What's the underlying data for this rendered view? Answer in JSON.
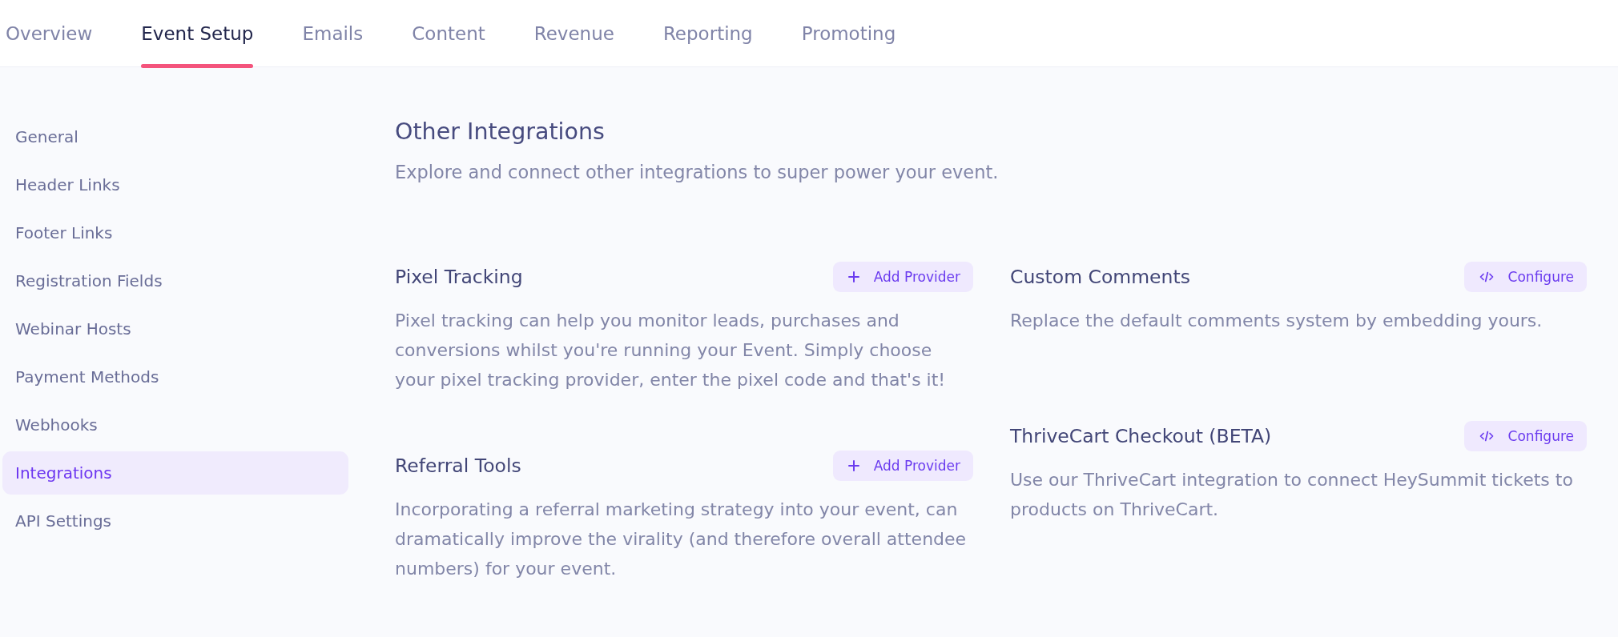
{
  "tabs": [
    {
      "label": "Overview",
      "selected": false
    },
    {
      "label": "Event Setup",
      "selected": true
    },
    {
      "label": "Emails",
      "selected": false
    },
    {
      "label": "Content",
      "selected": false
    },
    {
      "label": "Revenue",
      "selected": false
    },
    {
      "label": "Reporting",
      "selected": false
    },
    {
      "label": "Promoting",
      "selected": false
    }
  ],
  "sidebar": {
    "items": [
      {
        "label": "General",
        "selected": false
      },
      {
        "label": "Header Links",
        "selected": false
      },
      {
        "label": "Footer Links",
        "selected": false
      },
      {
        "label": "Registration Fields",
        "selected": false
      },
      {
        "label": "Webinar Hosts",
        "selected": false
      },
      {
        "label": "Payment Methods",
        "selected": false
      },
      {
        "label": "Webhooks",
        "selected": false
      },
      {
        "label": "Integrations",
        "selected": true
      },
      {
        "label": "API Settings",
        "selected": false
      }
    ]
  },
  "section": {
    "title": "Other Integrations",
    "subtitle": "Explore and connect other integrations to super power your event."
  },
  "columns": [
    {
      "cards": [
        {
          "title": "Pixel Tracking",
          "description": "Pixel tracking can help you monitor leads, purchases and conversions whilst you're running your Event. Simply choose your pixel tracking provider, enter the pixel code and that's it!",
          "button": {
            "kind": "add",
            "label": "Add Provider"
          }
        },
        {
          "title": "Referral Tools",
          "description": "Incorporating a referral marketing strategy into your event, can dramatically improve the virality (and therefore overall attendee numbers) for your event.",
          "button": {
            "kind": "add",
            "label": "Add Provider"
          }
        }
      ]
    },
    {
      "cards": [
        {
          "title": "Custom Comments",
          "description": "Replace the default comments system by embedding yours.",
          "button": {
            "kind": "configure",
            "label": "Configure"
          }
        },
        {
          "title": "ThriveCart Checkout (BETA)",
          "description": "Use our ThriveCart integration to connect HeySummit tickets to products on ThriveCart.",
          "button": {
            "kind": "configure",
            "label": "Configure"
          }
        }
      ]
    }
  ]
}
